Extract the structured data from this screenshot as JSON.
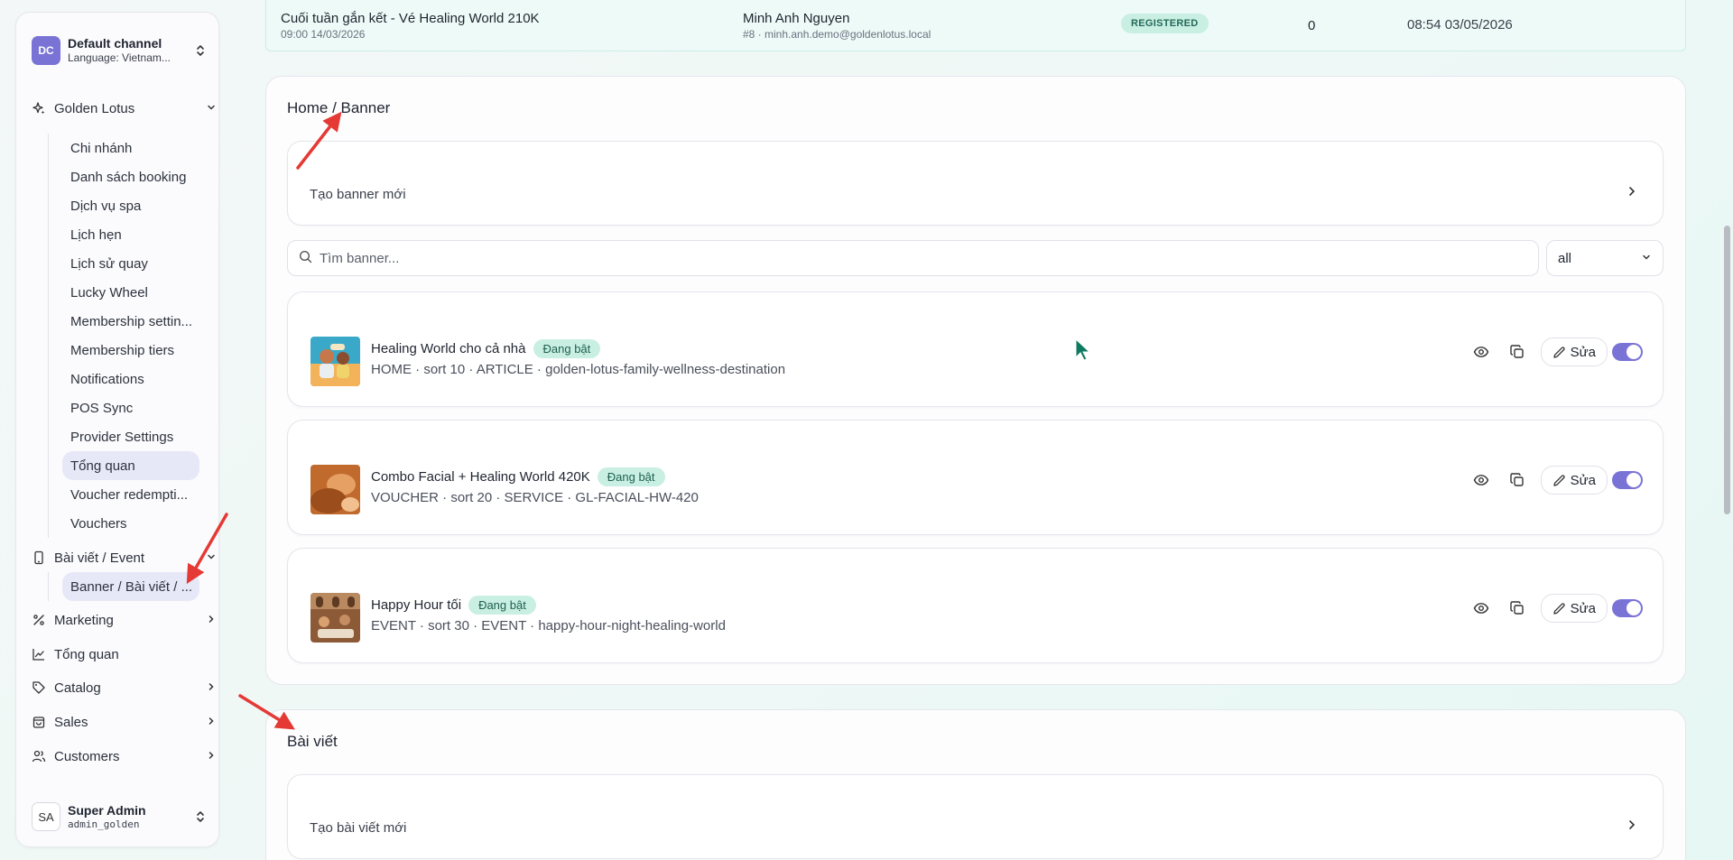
{
  "sidebar": {
    "channel": {
      "initials": "DC",
      "name": "Default channel",
      "language": "Language: Vietnam..."
    },
    "groups": {
      "golden_lotus": {
        "label": "Golden Lotus"
      },
      "bai_viet": {
        "label": "Bài viết / Event"
      },
      "marketing": {
        "label": "Marketing"
      },
      "tong_quan": {
        "label": "Tổng quan"
      },
      "catalog": {
        "label": "Catalog"
      },
      "sales": {
        "label": "Sales"
      },
      "customers": {
        "label": "Customers"
      }
    },
    "golden_lotus_items": [
      "Chi nhánh",
      "Danh sách booking",
      "Dịch vụ spa",
      "Lịch hẹn",
      "Lịch sử quay",
      "Lucky Wheel",
      "Membership settin...",
      "Membership tiers",
      "Notifications",
      "POS Sync",
      "Provider Settings",
      "Tổng quan",
      "Voucher redempti...",
      "Vouchers"
    ],
    "bai_viet_items": [
      "Banner / Bài viết / ..."
    ],
    "user": {
      "initials": "SA",
      "name": "Super Admin",
      "username": "admin_golden"
    }
  },
  "top_row": {
    "title": "Cuối tuần gắn kết - Vé Healing World 210K",
    "datetime": "09:00 14/03/2026",
    "customer": "Minh Anh Nguyen",
    "customer_detail": "#8 · minh.anh.demo@goldenlotus.local",
    "status": "REGISTERED",
    "count": "0",
    "created": "08:54 03/05/2026"
  },
  "banner_section": {
    "title": "Home / Banner",
    "create_label": "Tạo banner mới",
    "search_placeholder": "Tìm banner...",
    "filter_value": "all",
    "edit_label": "Sửa",
    "items": [
      {
        "title": "Healing World cho cả nhà",
        "status": "Đang bật",
        "meta": "HOME · sort 10 · ARTICLE · golden-lotus-family-wellness-destination"
      },
      {
        "title": "Combo Facial + Healing World 420K",
        "status": "Đang bật",
        "meta": "VOUCHER · sort 20 · SERVICE · GL-FACIAL-HW-420"
      },
      {
        "title": "Happy Hour tối",
        "status": "Đang bật",
        "meta": "EVENT · sort 30 · EVENT · happy-hour-night-healing-world"
      }
    ]
  },
  "article_section": {
    "title": "Bài viết",
    "create_label": "Tạo bài viết mới"
  },
  "colors": {
    "accent": "#7a73d6",
    "status_bg": "#c9efe3",
    "status_text": "#1e5f4e",
    "annotation_arrow": "#e53935"
  }
}
